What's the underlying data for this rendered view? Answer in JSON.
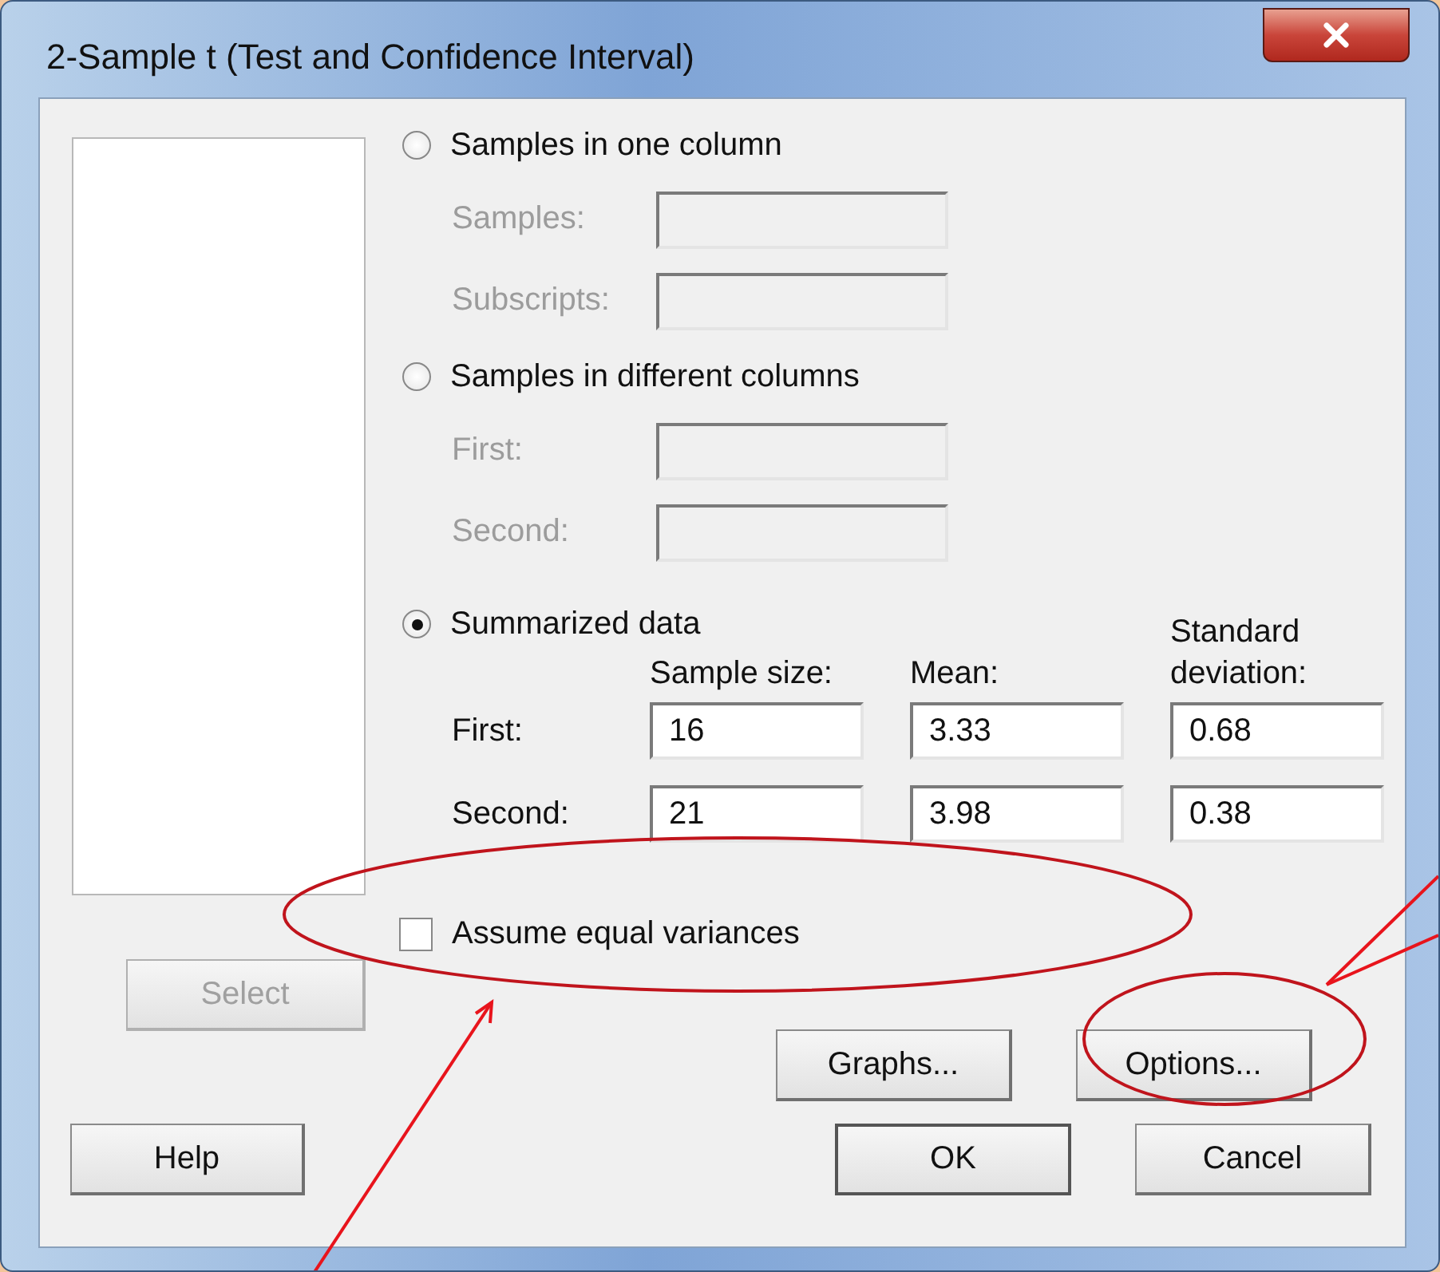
{
  "window": {
    "title": "2-Sample t (Test and Confidence Interval)"
  },
  "modes": [
    {
      "kind": "columns",
      "label": "Samples in one column",
      "selected": false,
      "fields": [
        {
          "label": "Samples:",
          "disabled": true
        },
        {
          "label": "Subscripts:",
          "disabled": true
        }
      ]
    },
    {
      "kind": "columns",
      "label": "Samples in different columns",
      "selected": false,
      "fields": [
        {
          "label": "First:",
          "disabled": true
        },
        {
          "label": "Second:",
          "disabled": true
        }
      ]
    },
    {
      "kind": "summary",
      "label": "Summarized data",
      "selected": true
    }
  ],
  "summarized": {
    "columns": [
      "Sample size:",
      "Mean:",
      "Standard deviation:"
    ],
    "rows": [
      {
        "label": "First:",
        "values": [
          "16",
          "3.33",
          "0.68"
        ]
      },
      {
        "label": "Second:",
        "values": [
          "21",
          "3.98",
          "0.38"
        ]
      }
    ]
  },
  "equal_variances": {
    "label": "Assume equal variances",
    "checked": false
  },
  "select_button": {
    "label": "Select",
    "disabled": true
  },
  "option_buttons": [
    {
      "label": "Graphs...",
      "disabled": false
    },
    {
      "label": "Options...",
      "disabled": false
    }
  ],
  "help_button": {
    "label": "Help",
    "disabled": false
  },
  "action_buttons": [
    {
      "label": "OK",
      "disabled": false
    },
    {
      "label": "Cancel",
      "disabled": false
    }
  ]
}
